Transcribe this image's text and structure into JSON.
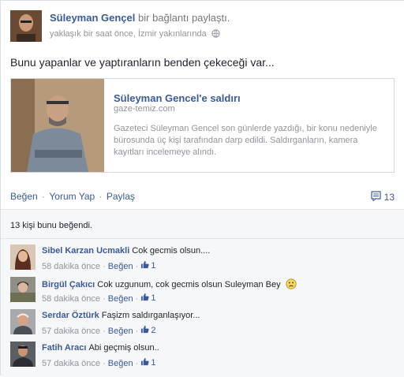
{
  "post": {
    "author": "Süleyman Gençel",
    "action": "bir bağlantı paylaştı.",
    "time": "yaklaşık bir saat önce, İzmir yakınlarında",
    "status": "Bunu yapanlar ve yaptıranların benden çekeceği var..."
  },
  "link": {
    "title": "Süleyman Gencel'e saldırı",
    "domain": "gaze-temiz.com",
    "description": "Gazeteci Süleyman Gencel son günlerde yazdığı, bir konu nedeniyle bürosunda üç kişi tarafından darp edildi. Saldırganların, kamera kayıtları incelemeye alındı."
  },
  "actions": {
    "like": "Beğen",
    "comment": "Yorum Yap",
    "share": "Paylaş",
    "comment_count": "13"
  },
  "likes_text": "13 kişi bunu beğendi.",
  "comments": [
    {
      "name": "Sibel Karzan Ucmakli",
      "text": "Cok gecmis olsun....",
      "time": "58 dakika önce",
      "like": "Beğen",
      "likes": "1"
    },
    {
      "name": "Birgül Çakıcı",
      "text": "Cok uzgunum, cok gecmis olsun Suleyman Bey",
      "time": "58 dakika önce",
      "like": "Beğen",
      "likes": "1"
    },
    {
      "name": "Serdar Öztürk",
      "text": "Faşizm saldırganlaşıyor...",
      "time": "57 dakika önce",
      "like": "Beğen",
      "likes": "2"
    },
    {
      "name": "Fatih Aracı",
      "text": "Abi geçmiş olsun..",
      "time": "57 dakika önce",
      "like": "Beğen",
      "likes": "1"
    }
  ]
}
